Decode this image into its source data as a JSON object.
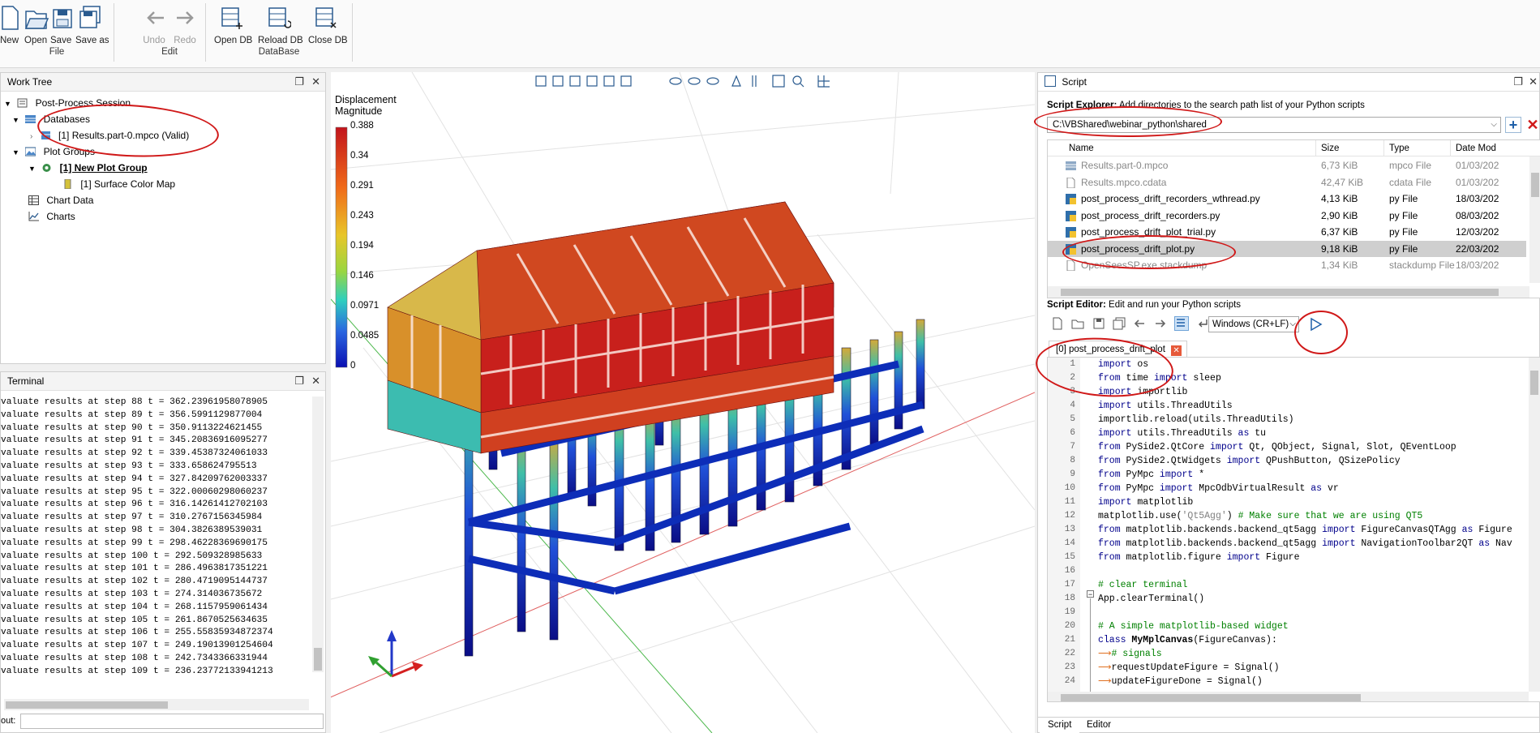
{
  "ribbon": {
    "file": {
      "new": "New",
      "open": "Open",
      "save": "Save",
      "save_as": "Save as",
      "group": "File"
    },
    "edit": {
      "undo": "Undo",
      "redo": "Redo",
      "group": "Edit"
    },
    "database": {
      "open_db": "Open DB",
      "reload_db": "Reload DB",
      "close_db": "Close DB",
      "group": "DataBase"
    }
  },
  "work_tree": {
    "title": "Work Tree",
    "items": {
      "session": "Post-Process Session",
      "databases": "Databases",
      "result": "[1] Results.part-0.mpco (Valid)",
      "plot_groups": "Plot Groups",
      "new_plot_group": "[1] New Plot Group",
      "surface_map": "[1] Surface Color Map",
      "chart_data": "Chart Data",
      "charts": "Charts"
    }
  },
  "terminal": {
    "title": "Terminal",
    "lines": [
      "valuate results at step 88 t = 362.23961958078905",
      "valuate results at step 89 t = 356.5991129877004",
      "valuate results at step 90 t = 350.9113224621455",
      "valuate results at step 91 t = 345.20836916095277",
      "valuate results at step 92 t = 339.45387324061033",
      "valuate results at step 93 t = 333.658624795513",
      "valuate results at step 94 t = 327.84209762003337",
      "valuate results at step 95 t = 322.00060298060237",
      "valuate results at step 96 t = 316.14261412702103",
      "valuate results at step 97 t = 310.2767156345984",
      "valuate results at step 98 t = 304.3826389539031",
      "valuate results at step 99 t = 298.46228369690175",
      "valuate results at step 100 t = 292.509328985633",
      "valuate results at step 101 t = 286.4963817351221",
      "valuate results at step 102 t = 280.4719095144737",
      "valuate results at step 103 t = 274.314036735672",
      "valuate results at step 104 t = 268.1157959061434",
      "valuate results at step 105 t = 261.8670525634635",
      "valuate results at step 106 t = 255.55835934872374",
      "valuate results at step 107 t = 249.19013901254604",
      "valuate results at step 108 t = 242.7343366331944",
      "valuate results at step 109 t = 236.23772133941213"
    ],
    "input_label": "out:"
  },
  "viewport": {
    "legend_title_1": "Displacement",
    "legend_title_2": "Magnitude",
    "legend_ticks": [
      "0.388",
      "0.34",
      "0.291",
      "0.243",
      "0.194",
      "0.146",
      "0.0971",
      "0.0485",
      "0"
    ]
  },
  "script": {
    "title": "Script",
    "explorer_label": "Script Explorer:",
    "explorer_desc": "Add directories to the search path list of your Python scripts",
    "path": "C:\\VBShared\\webinar_python\\shared",
    "columns": {
      "name": "Name",
      "size": "Size",
      "type": "Type",
      "date": "Date Mod"
    },
    "files": [
      {
        "name": "Results.part-0.mpco",
        "size": "6,73 KiB",
        "type": "mpco File",
        "date": "01/03/202",
        "icon": "db-icon",
        "dim": true
      },
      {
        "name": "Results.mpco.cdata",
        "size": "42,47 KiB",
        "type": "cdata File",
        "date": "01/03/202",
        "icon": "file-icon",
        "dim": true
      },
      {
        "name": "post_process_drift_recorders_wthread.py",
        "size": "4,13 KiB",
        "type": "py File",
        "date": "18/03/202",
        "icon": "python-icon",
        "dim": false
      },
      {
        "name": "post_process_drift_recorders.py",
        "size": "2,90 KiB",
        "type": "py File",
        "date": "08/03/202",
        "icon": "python-icon",
        "dim": false
      },
      {
        "name": "post_process_drift_plot_trial.py",
        "size": "6,37 KiB",
        "type": "py File",
        "date": "12/03/202",
        "icon": "python-icon",
        "dim": false
      },
      {
        "name": "post_process_drift_plot.py",
        "size": "9,18 KiB",
        "type": "py File",
        "date": "22/03/202",
        "icon": "python-icon",
        "dim": false
      },
      {
        "name": "OpenSeesSP.exe.stackdump",
        "size": "1,34 KiB",
        "type": "stackdump File",
        "date": "18/03/202",
        "icon": "file-icon",
        "dim": true
      }
    ],
    "editor_label": "Script Editor:",
    "editor_desc": "Edit and run your Python scripts",
    "line_ending": "Windows (CR+LF)",
    "tab": "[0] post_process_drift_plot",
    "bottom_tabs": {
      "script": "Script",
      "editor": "Editor"
    }
  },
  "code": {
    "line_numbers": [
      "1",
      "2",
      "3",
      "4",
      "5",
      "6",
      "7",
      "8",
      "9",
      "10",
      "11",
      "12",
      "13",
      "14",
      "15",
      "16",
      "17",
      "18",
      "19",
      "20",
      "21",
      "22",
      "23",
      "24"
    ],
    "l1": {
      "k1": "import",
      "t1": " os"
    },
    "l2": {
      "k1": "from",
      "t1": " time ",
      "k2": "import",
      "t2": " sleep"
    },
    "l3": {
      "k1": "import",
      "t1": " importlib"
    },
    "l4": {
      "k1": "import",
      "t1": " utils.ThreadUtils"
    },
    "l5": {
      "t1": "importlib.reload(utils.ThreadUtils)"
    },
    "l6": {
      "k1": "import",
      "t1": " utils.ThreadUtils ",
      "k2": "as",
      "t2": " tu"
    },
    "l7": {
      "k1": "from",
      "t1": " PySide2.QtCore ",
      "k2": "import",
      "t2": " Qt, QObject, Signal, Slot, QEventLoop"
    },
    "l8": {
      "k1": "from",
      "t1": " PySide2.QtWidgets ",
      "k2": "import",
      "t2": " QPushButton, QSizePolicy"
    },
    "l9": {
      "k1": "from",
      "t1": " PyMpc ",
      "k2": "import",
      "t2": " *"
    },
    "l10": {
      "k1": "from",
      "t1": " PyMpc ",
      "k2": "import",
      "t2": " MpcOdbVirtualResult ",
      "k3": "as",
      "t3": " vr"
    },
    "l11": {
      "k1": "import",
      "t1": " matplotlib"
    },
    "l12": {
      "t1": "matplotlib.use(",
      "s1": "'Qt5Agg'",
      "t2": ") ",
      "c1": "# Make sure that we are using QT5"
    },
    "l13": {
      "k1": "from",
      "t1": " matplotlib.backends.backend_qt5agg ",
      "k2": "import",
      "t2": " FigureCanvasQTAgg ",
      "k3": "as",
      "t3": " Figure"
    },
    "l14": {
      "k1": "from",
      "t1": " matplotlib.backends.backend_qt5agg ",
      "k2": "import",
      "t2": " NavigationToolbar2QT ",
      "k3": "as",
      "t3": " Nav"
    },
    "l15": {
      "k1": "from",
      "t1": " matplotlib.figure ",
      "k2": "import",
      "t2": " Figure"
    },
    "l17": {
      "c1": "# clear terminal"
    },
    "l18": {
      "t1": "App.clearTerminal()"
    },
    "l20": {
      "c1": "# A simple matplotlib-based widget"
    },
    "l21": {
      "k1": "class",
      "f1": " MyMplCanvas",
      "t1": "(FigureCanvas):"
    },
    "l22": {
      "c1": "# signals"
    },
    "l23": {
      "t1": "requestUpdateFigure = Signal()"
    },
    "l24": {
      "t1": "updateFigureDone = Signal()"
    }
  },
  "colors": {
    "annotation": "#d01818",
    "keyword": "#00008b",
    "comment": "#008000",
    "selection": "#cfcfcf"
  }
}
